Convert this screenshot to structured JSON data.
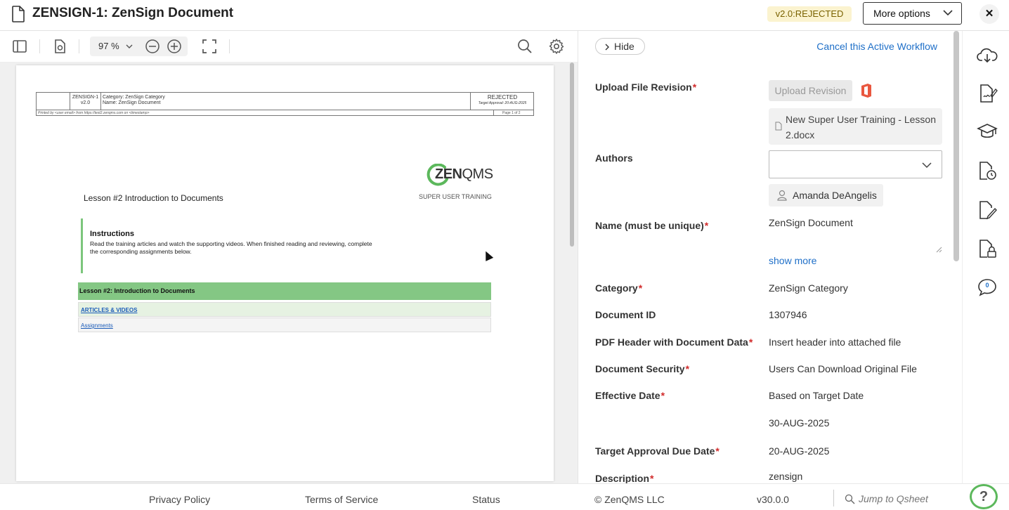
{
  "header": {
    "title": "ZENSIGN-1: ZenSign Document",
    "version_badge": "v2.0:REJECTED",
    "more_options": "More options",
    "close": "✕"
  },
  "toolbar": {
    "zoom": "97 %"
  },
  "pdf": {
    "header": {
      "doc_number": "ZENSIGN-1",
      "doc_version": "v2.0",
      "category_line": "Category: ZenSign Category",
      "name_line": "Name: ZenSign Document",
      "status": "REJECTED",
      "target": "Target Approval: 20-AUG-2025",
      "printed_by": "Printed by <user email> from https://test2.zenqms.com on <timestamp>",
      "page": "Page 1 of 2"
    },
    "logo": {
      "text_bold": "ZEN",
      "text_light": "QMS",
      "tagline": "SUPER USER TRAINING"
    },
    "lesson_title": "Lesson #2 Introduction to Documents",
    "instructions_heading": "Instructions",
    "instructions_text": "Read the training articles and watch the supporting videos. When finished reading and reviewing, complete the corresponding assignments below.",
    "lesson_bar": "Lesson #2: Introduction to Documents",
    "rows": [
      "ARTICLES & VIDEOS",
      "Assignments"
    ]
  },
  "panel": {
    "hide_label": "Hide",
    "cancel_workflow": "Cancel this Active Workflow",
    "upload_label": "Upload File Revision",
    "upload_button": "Upload Revision",
    "file_name": "New Super User Training - Lesson 2.docx",
    "authors_label": "Authors",
    "author": "Amanda DeAngelis",
    "name_label": "Name (must be unique)",
    "name_value": "ZenSign Document",
    "show_more": "show more",
    "fields": [
      {
        "label": "Category",
        "required": "*",
        "value": "ZenSign Category"
      },
      {
        "label": "Document ID",
        "required": "",
        "value": "1307946"
      },
      {
        "label": "PDF Header with Document Data",
        "required": "*",
        "value": "Insert header into attached file"
      },
      {
        "label": "Document Security",
        "required": "*",
        "value": "Users Can Download Original File"
      },
      {
        "label": "Effective Date",
        "required": "*",
        "value": "Based on Target Date"
      },
      {
        "label": "",
        "required": "",
        "value": "30-AUG-2025"
      },
      {
        "label": "Target Approval Due Date",
        "required": "*",
        "value": "20-AUG-2025"
      },
      {
        "label": "Description",
        "required": "*",
        "value": "zensign"
      }
    ],
    "required_mark": "*"
  },
  "rail": {
    "comment_count": "0"
  },
  "footer": {
    "privacy": "Privacy Policy",
    "terms": "Terms of Service",
    "status": "Status",
    "copyright": "© ZenQMS LLC",
    "version": "v30.0.0",
    "qsheet_placeholder": "Jump to Qsheet",
    "help": "?"
  },
  "colors": {
    "accent_blue": "#1e6fc8",
    "required_red": "#d12b2b",
    "lesson_green": "#84c784",
    "badge_bg": "#fbf3cf"
  }
}
